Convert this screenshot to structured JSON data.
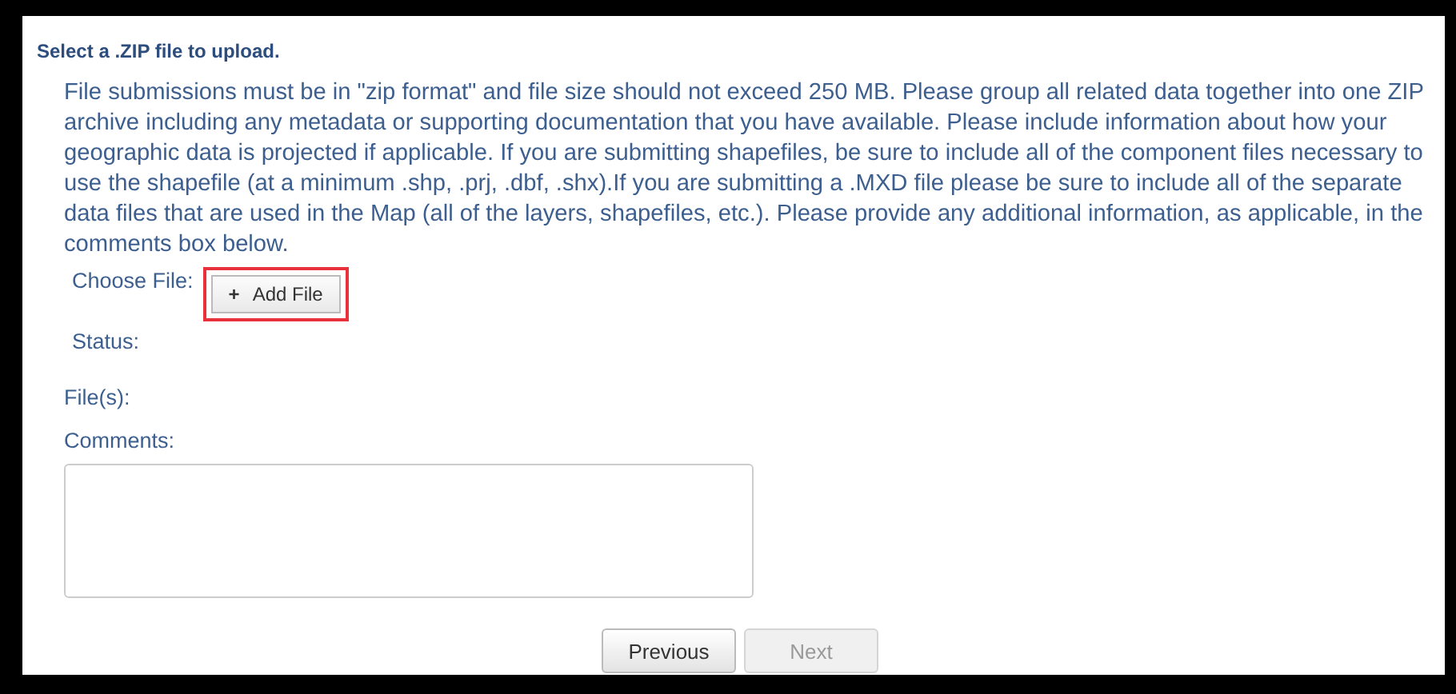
{
  "heading": "Select a .ZIP file to upload.",
  "instructions": "File submissions must be in \"zip format\" and file size should not exceed 250 MB. Please group all related data together into one ZIP archive including any metadata or supporting documentation that you have available. Please include information about how your geographic data is projected if applicable. If you are submitting shapefiles, be sure to include all of the component files necessary to use the shapefile (at a minimum .shp, .prj, .dbf, .shx).If you are submitting a .MXD file please be sure to include all of the separate data files that are used in the Map (all of the layers, shapefiles, etc.). Please provide any additional information, as applicable, in the comments box below.",
  "choose_file": {
    "label": "Choose File:",
    "button": {
      "icon": "+",
      "label": "Add File",
      "highlighted": true
    }
  },
  "status": {
    "label": "Status:"
  },
  "files": {
    "label": "File(s):"
  },
  "comments": {
    "label": "Comments:"
  },
  "buttons": [
    {
      "label": "Previous",
      "disabled": false
    },
    {
      "label": "Next",
      "disabled": true
    }
  ]
}
